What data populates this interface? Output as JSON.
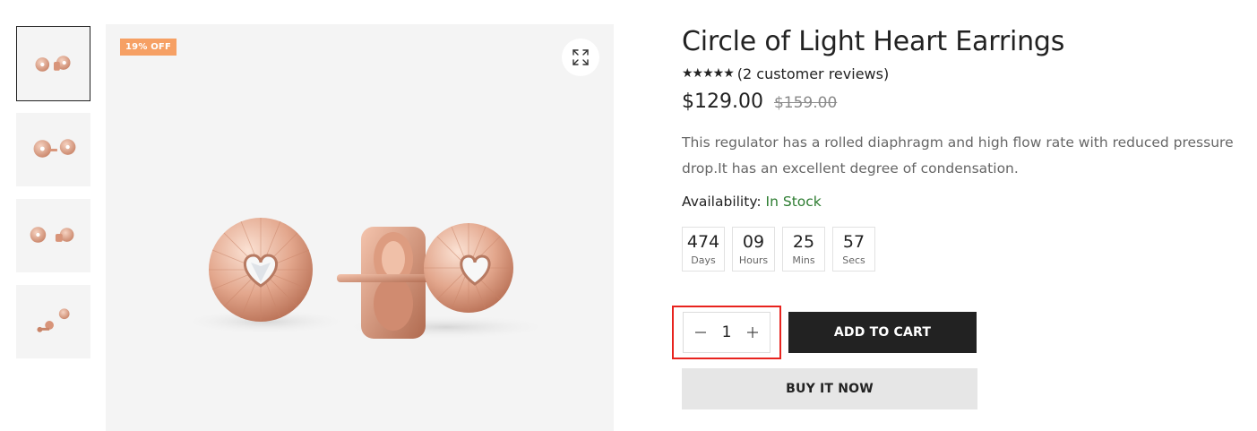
{
  "gallery": {
    "thumbnails": [
      {
        "alt": "thumbnail-1"
      },
      {
        "alt": "thumbnail-2"
      },
      {
        "alt": "thumbnail-3"
      },
      {
        "alt": "thumbnail-4"
      }
    ],
    "badge": "19% OFF",
    "zoom_icon": "expand-icon"
  },
  "product": {
    "title": "Circle of Light Heart Earrings",
    "stars": "★★★★★",
    "reviews": "(2 customer reviews)",
    "price": "$129.00",
    "price_old": "$159.00",
    "description": "This regulator has a rolled diaphragm and high flow rate with reduced pressure drop.It has an excellent degree of condensation.",
    "availability_label": "Availability:",
    "availability_value": "In Stock",
    "stock_color": "#2e7d32"
  },
  "countdown": [
    {
      "value": "474",
      "label": "Days"
    },
    {
      "value": "09",
      "label": "Hours"
    },
    {
      "value": "25",
      "label": "Mins"
    },
    {
      "value": "57",
      "label": "Secs"
    }
  ],
  "cart": {
    "quantity": "1",
    "minus_icon": "minus-icon",
    "plus_icon": "plus-icon",
    "add_to_cart": "ADD TO CART",
    "buy_now": "BUY IT NOW",
    "highlight_color": "#e8231e"
  }
}
